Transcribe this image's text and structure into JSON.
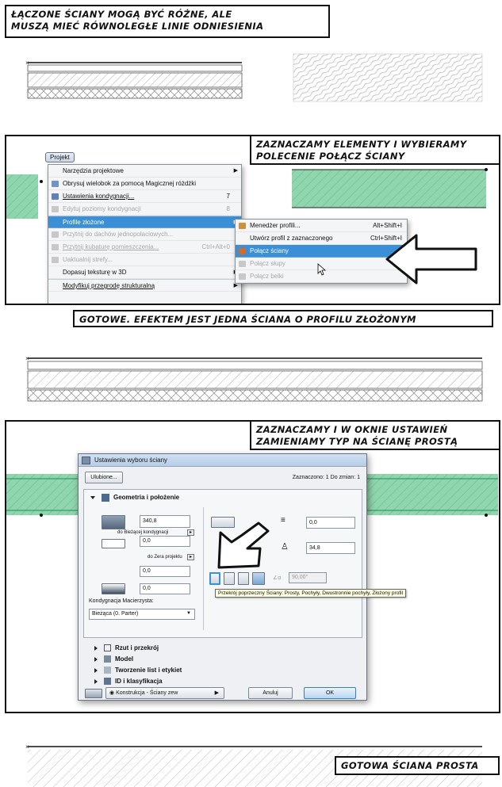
{
  "captions": {
    "top": [
      "ŁĄCZONE ŚCIANY MOGĄ BYĆ RÓŻNE, ALE",
      "MUSZĄ MIEĆ RÓWNOLEGŁE LINIE ODNIESIENIA"
    ],
    "select": [
      "ZAZNACZAMY ELEMENTY I WYBIERAMY",
      "POLECENIE POŁĄCZ ŚCIANY"
    ],
    "done": "GOTOWE. EFEKTEM JEST JEDNA ŚCIANA O PROFILU ZŁOŻONYM",
    "dialog": [
      "ZAZNACZAMY I W OKNIE USTAWIEŃ",
      "ZAMIENIAMY TYP NA ŚCIANĘ PROSTĄ"
    ],
    "final": "GOTOWA ŚCIANA PROSTA"
  },
  "menu": {
    "title": "Projekt",
    "items": [
      {
        "label": "Narzędzia projektowe",
        "arrow": true,
        "disabled": false
      },
      {
        "label": "Obrysuj wielobok za pomocą Magicznej różdżki",
        "disabled": false
      },
      {
        "label": "Ustawienia kondygnacji...",
        "shortcut": "7",
        "disabled": false
      },
      {
        "label": "Edytuj poziomy kondygnacji",
        "shortcut": "8",
        "disabled": true
      },
      {
        "label": "Profile złożone",
        "arrow": true,
        "highlight": true
      },
      {
        "label": "Przytnij do dachów jednopołaciowych...",
        "disabled": true
      },
      {
        "label": "Przytnij kubaturę pomieszczenia...",
        "shortcut": "Ctrl+Alt+0",
        "disabled": true
      },
      {
        "label": "Uaktualnij strefy...",
        "disabled": true
      },
      {
        "label": "Dopasuj teksturę w 3D",
        "arrow": true,
        "disabled": false
      },
      {
        "label": "Modyfikuj przegrodę strukturalną",
        "arrow": true,
        "disabled": false
      }
    ],
    "submenu": [
      {
        "label": "Menedżer profili...",
        "shortcut": "Alt+Shift+I",
        "disabled": false
      },
      {
        "label": "Utwórz profil z zaznaczonego",
        "shortcut": "Ctrl+Shift+I",
        "disabled": false
      },
      {
        "label": "Połącz ściany",
        "highlight": true
      },
      {
        "label": "Połącz słupy",
        "disabled": true
      },
      {
        "label": "Połącz belki",
        "disabled": true
      }
    ]
  },
  "dialog": {
    "title": "Ustawienia wyboru ściany",
    "favorites": "Ulubione...",
    "selected": "Zaznaczono: 1 Do zmian: 1",
    "section_geometry": "Geometria i położenie",
    "height": "340,8",
    "to_story_label": "do Bieżącej kondygnacji",
    "offset_story": "0,0",
    "to_project_zero_label": "do Zera projektu",
    "offset_zero": "0,0",
    "base_offset": "0,0",
    "home_story_label": "Kondygnacja Macierzysta:",
    "home_story": "Bieżąca (0. Parter)",
    "right_value1": "0,0",
    "thickness": "34,8",
    "angle": "90,00°",
    "tooltip": "Przekrój poprzeczny Ściany: Prosty, Pochyły, Dwustronnie pochyły, Złożony profil",
    "sections": [
      "Rzut i przekrój",
      "Model",
      "Tworzenie list i etykiet",
      "ID i klasyfikacja"
    ],
    "layer": "Konstrukcja - Ściany zew",
    "cancel": "Anuluj",
    "ok": "OK"
  },
  "colors": {
    "wall_green": "#8fd5ad",
    "highlight": "#3a8fd6",
    "wall_line": "#111111"
  }
}
